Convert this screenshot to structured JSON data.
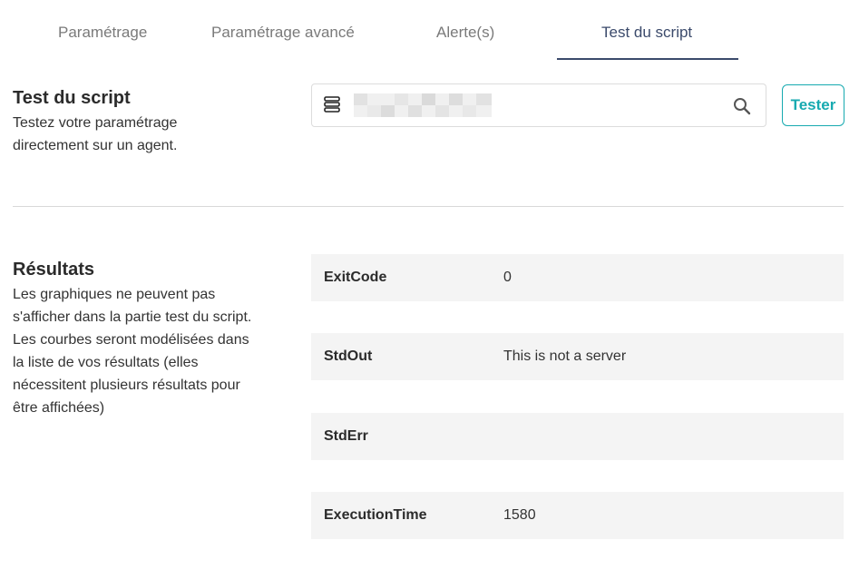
{
  "tabs": [
    {
      "label": "Paramétrage"
    },
    {
      "label": "Paramétrage avancé"
    },
    {
      "label": "Alerte(s)"
    },
    {
      "label": "Test du script"
    }
  ],
  "active_tab": "Test du script",
  "test_section": {
    "title": "Test du script",
    "description_line1": "Testez votre paramétrage",
    "description_line2": "directement sur un agent."
  },
  "search": {
    "value": "",
    "icon": "search-icon",
    "agent_icon": "server-icon"
  },
  "tester_button": {
    "label": "Tester"
  },
  "results_section": {
    "title": "Résultats",
    "description_lines": [
      "Les graphiques ne peuvent pas",
      "s'afficher dans la partie test du script.",
      "Les courbes seront modélisées dans",
      "la liste de vos résultats (elles",
      "nécessitent plusieurs résultats pour",
      "être affichées)"
    ]
  },
  "results": [
    {
      "key": "ExitCode",
      "value": "0"
    },
    {
      "key": "StdOut",
      "value": "This is not a server"
    },
    {
      "key": "StdErr",
      "value": ""
    },
    {
      "key": "ExecutionTime",
      "value": "1580"
    }
  ],
  "colors": {
    "accent": "#17aab0",
    "tab_active": "#3b4a6b",
    "row_bg": "#f4f4f4"
  }
}
